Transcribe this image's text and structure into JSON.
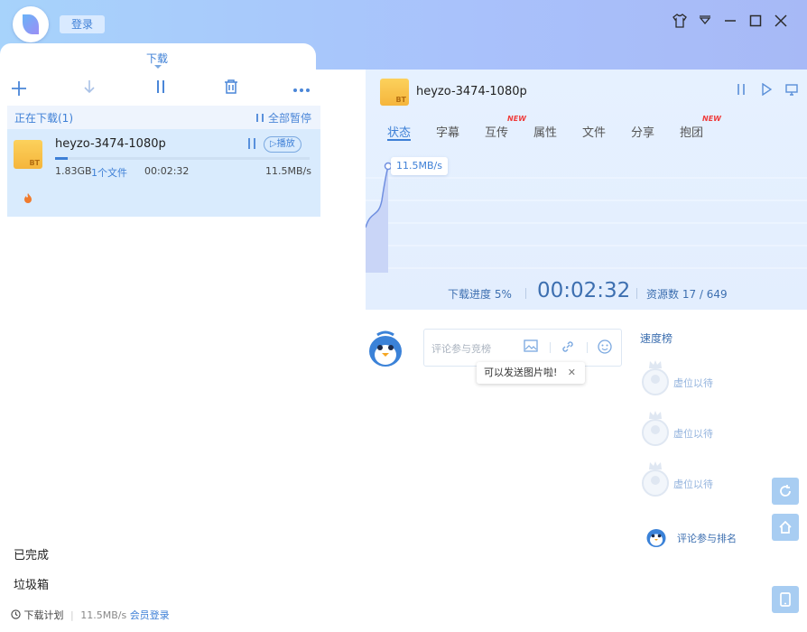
{
  "app": {
    "login_label": "登录",
    "window_controls": [
      "shirt-icon",
      "dropdown-icon",
      "minimize-icon",
      "maximize-icon",
      "close-icon"
    ]
  },
  "download_tab": {
    "label": "下载"
  },
  "toolbar": {
    "add_icon": "+",
    "download_icon": "↓",
    "pause_icon": "❙❙",
    "trash_icon": "🗑",
    "more_icon": "•••"
  },
  "downloading_section": {
    "title": "正在下载(1)",
    "pause_all_label": "全部暂停"
  },
  "task": {
    "name": "heyzo-3474-1080p",
    "size": "1.83GB",
    "files": "1个文件",
    "elapsed": "00:02:32",
    "speed": "11.5MB/s",
    "play_label": "▷播放",
    "progress_fraction": 0.05,
    "bt_badge": "BT"
  },
  "nav": {
    "completed": "已完成",
    "trash": "垃圾箱"
  },
  "footer": {
    "plan_label": "下载计划",
    "speed": "11.5MB/s",
    "vip_login": "会员登录"
  },
  "detail": {
    "title": "heyzo-3474-1080p",
    "bt_badge": "BT",
    "tabs": [
      {
        "label": "状态",
        "active": true,
        "new": false
      },
      {
        "label": "字幕",
        "active": false,
        "new": false
      },
      {
        "label": "互传",
        "active": false,
        "new": true
      },
      {
        "label": "属性",
        "active": false,
        "new": false
      },
      {
        "label": "文件",
        "active": false,
        "new": false
      },
      {
        "label": "分享",
        "active": false,
        "new": false
      },
      {
        "label": "抱团",
        "active": false,
        "new": true
      }
    ],
    "new_badge": "NEW",
    "speed_tip": "11.5MB/s",
    "progress_label": "下载进度 5%",
    "time": "00:02:32",
    "resources_label": "资源数 17 / 649"
  },
  "comment": {
    "placeholder": "评论参与竞榜",
    "tooltip": "可以发送图片啦!",
    "tooltip_close": "✕"
  },
  "rank": {
    "title": "速度榜",
    "items": [
      {
        "rank": "1",
        "label": "虚位以待"
      },
      {
        "rank": "2",
        "label": "虚位以待"
      },
      {
        "rank": "3",
        "label": "虚位以待"
      }
    ],
    "me_label": "评论参与排名"
  },
  "colors": {
    "accent": "#3d7fd6",
    "titlebar": "#a9c1fb",
    "selected_task": "#d9ebfd",
    "new_badge": "#ef3d3d"
  }
}
